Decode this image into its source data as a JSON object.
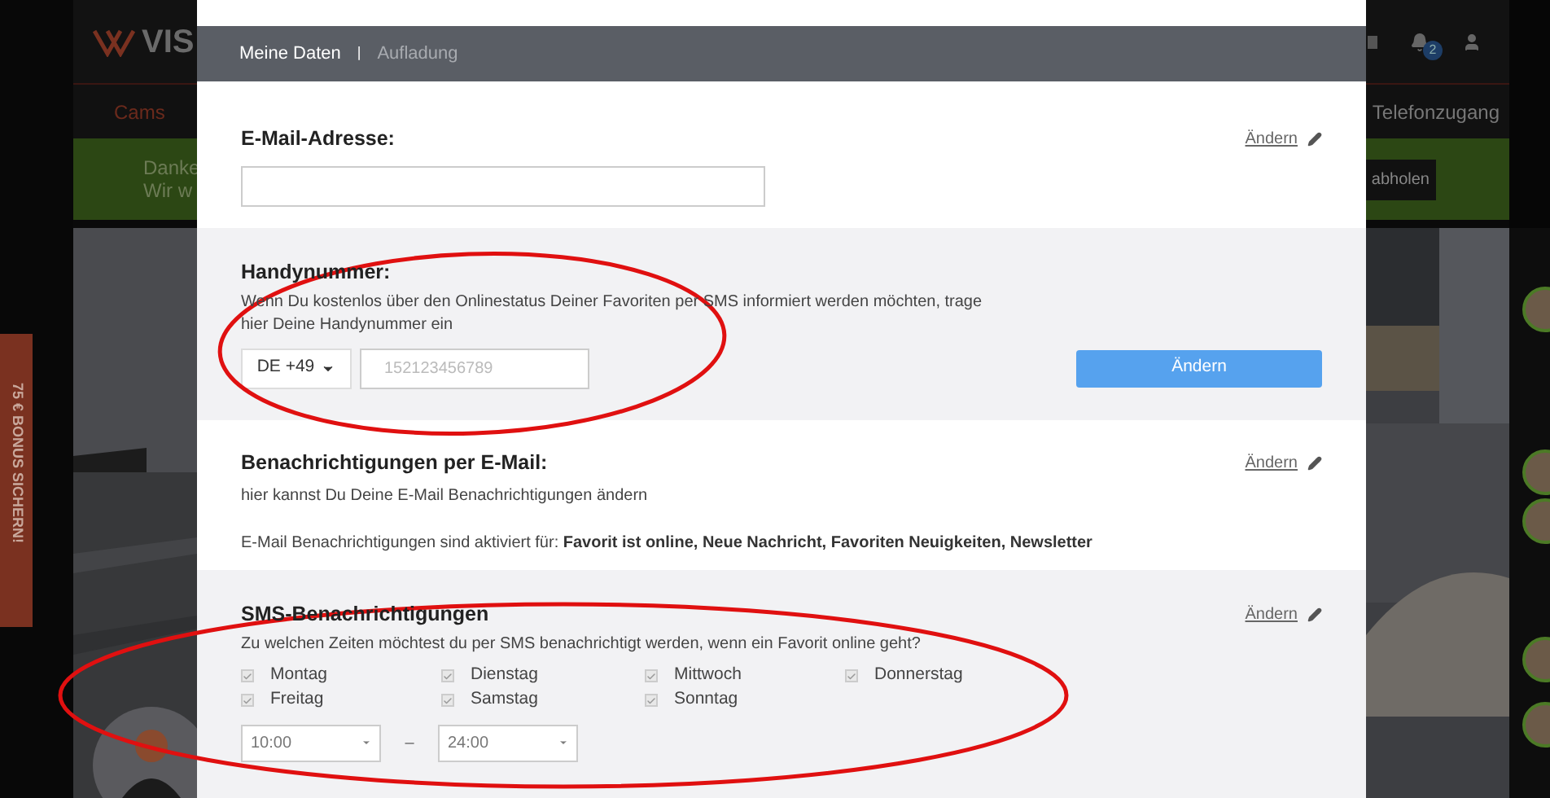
{
  "header": {
    "logo": "VIS",
    "notification_count": "2"
  },
  "nav": {
    "left_item": "Cams",
    "right_item": "Telefonzugang"
  },
  "banner": {
    "lines": [
      "Danke",
      "Wir w"
    ],
    "button": "abholen"
  },
  "side_tab": "75 € BONUS SICHERN!",
  "modal": {
    "tabs": [
      {
        "label": "Meine Daten",
        "selected": true
      },
      {
        "label": "Aufladung",
        "selected": false
      }
    ],
    "tab_separator": "|",
    "email_section": {
      "title": "E-Mail-Adresse:",
      "link": "Ändern"
    },
    "phone_section": {
      "title": "Handynummer:",
      "description": "Wenn Du kostenlos über den Onlinestatus Deiner Favoriten per SMS informiert werden möchten, trage hier Deine Handynummer ein",
      "country": "DE +49",
      "placeholder": "152123456789",
      "button": "Ändern"
    },
    "email_notifications": {
      "title": "Benachrichtigungen per E-Mail:",
      "subtitle": "hier kannst Du Deine E-Mail Benachrichtigungen ändern",
      "status": "E-Mail Benachrichtigungen sind aktiviert für: **Favorit ist online, Neue Nachricht, Favoriten Neuigkeiten, Newsletter**",
      "link": "Ändern"
    },
    "sms_notifications": {
      "title": "SMS-Benachrichtigungen",
      "question": "Zu welchen Zeiten möchtest du per SMS benachrichtigt werden, wenn ein Favorit online geht?",
      "link": "Ändern",
      "days": [
        {
          "label": "Montag",
          "checked": true
        },
        {
          "label": "Dienstag",
          "checked": true
        },
        {
          "label": "Mittwoch",
          "checked": true
        },
        {
          "label": "Donnerstag",
          "checked": true
        },
        {
          "label": "Freitag",
          "checked": true
        },
        {
          "label": "Samstag",
          "checked": true
        },
        {
          "label": "Sonntag",
          "checked": true
        }
      ],
      "from": "10:00",
      "separator": "–",
      "to": "24:00"
    }
  }
}
